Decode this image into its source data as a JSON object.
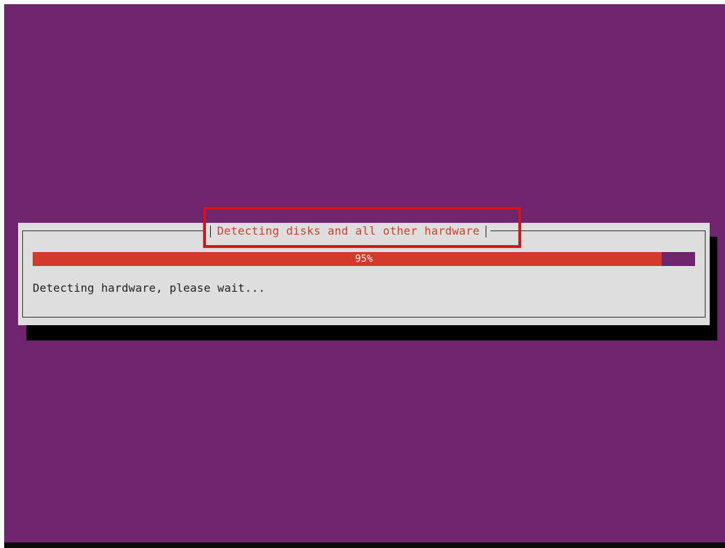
{
  "dialog": {
    "title": "Detecting disks and all other hardware",
    "status_text": "Detecting hardware, please wait..."
  },
  "progress": {
    "value_percent": 95,
    "label": "95%"
  },
  "colors": {
    "background": "#6f256e",
    "dialog_bg": "#dedede",
    "progress_fill": "#d33a2c",
    "title_text": "#d23a2a",
    "highlight": "#d6121c"
  }
}
